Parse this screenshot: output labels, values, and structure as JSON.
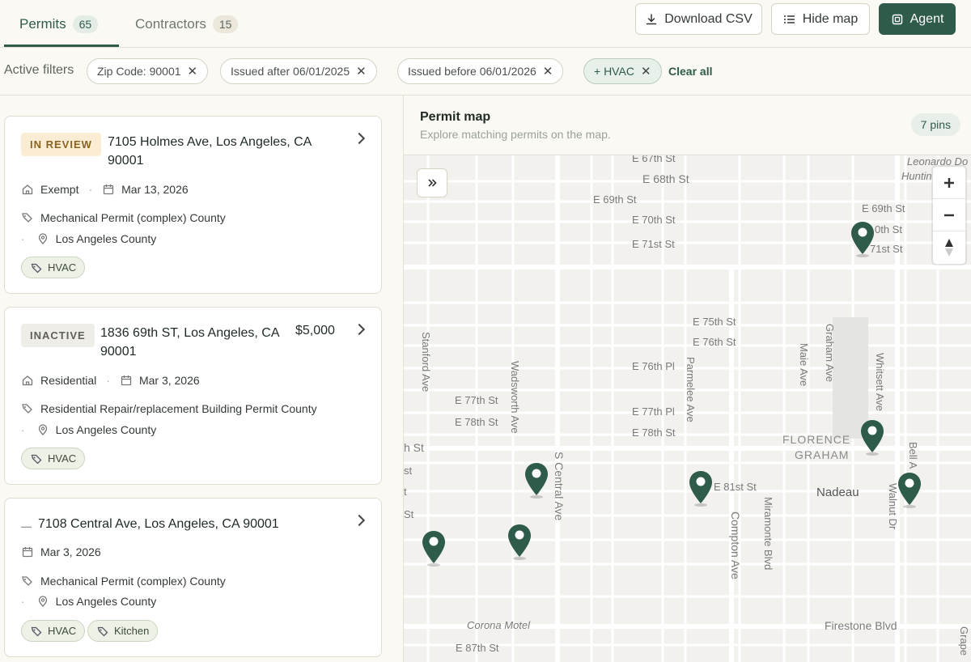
{
  "tabs": [
    {
      "label": "Permits",
      "count": "65"
    },
    {
      "label": "Contractors",
      "count": "15"
    }
  ],
  "actions": {
    "download": "Download CSV",
    "hide_map": "Hide map",
    "agent": "Agent"
  },
  "filters": {
    "label": "Active filters",
    "chips": [
      "Zip Code: 90001",
      "Issued after 06/01/2025",
      "Issued before 06/01/2026",
      "+ HVAC"
    ],
    "clear": "Clear all"
  },
  "permits": [
    {
      "status": "IN REVIEW",
      "address_line1": "7105 Holmes Ave, Los Angeles, CA",
      "address_line2": "90001",
      "price": "",
      "type": "Exempt",
      "date": "Mar 13, 2026",
      "permit_desc": "Mechanical Permit (complex) County",
      "jurisdiction": "Los Angeles County",
      "tags": [
        "HVAC"
      ]
    },
    {
      "status": "INACTIVE",
      "address_line1": "1836 69th ST, Los Angeles, CA",
      "address_line2": "90001",
      "price": "$5,000",
      "type": "Residential",
      "date": "Mar 3, 2026",
      "permit_desc": "Residential Repair/replacement Building Permit County",
      "jurisdiction": "Los Angeles County",
      "tags": [
        "HVAC"
      ]
    },
    {
      "status": "—",
      "address_line1": "7108 Central Ave, Los Angeles, CA 90001",
      "address_line2": "",
      "price": "",
      "type": "",
      "date": "Mar 3, 2026",
      "permit_desc": "Mechanical Permit (complex) County",
      "jurisdiction": "Los Angeles County",
      "tags": [
        "HVAC",
        "Kitchen"
      ]
    }
  ],
  "map": {
    "title": "Permit map",
    "subtitle": "Explore matching permits on the map.",
    "pins_label": "7 pins",
    "streets": {
      "e67": "E 67th St",
      "e68": "E 68th St",
      "e69": "E 69th St",
      "e70": "E 70th St",
      "e71": "E 71st St",
      "e69r": "E 69th St",
      "e70r": "0th St",
      "e71r": "71st St",
      "e75": "E 75th St",
      "e76": "E 76th St",
      "e76pl": "E 76th Pl",
      "e77pl": "E 77th Pl",
      "e78r": "E 78th St",
      "e77": "E 77th St",
      "e78": "E 78th St",
      "e81": "E 81st St",
      "e87": "E 87th St",
      "hst": "h St",
      "st1": "st",
      "st2": "t",
      "st3": "St",
      "stanford": "Stanford Ave",
      "wadsworth": "Wadsworth Ave",
      "central": "S Central Ave",
      "parmelee": "Parmelee Ave",
      "maie": "Maie Ave",
      "graham": "Graham Ave",
      "whitsett": "Whitsett Ave",
      "bell": "Bell A",
      "walnut": "Walnut Dr",
      "compton": "Compton Ave",
      "miramonte": "Miramonte Blvd",
      "florence": "FLORENCE",
      "graham_area": "GRAHAM",
      "nadeau": "Nadeau",
      "leonardo1": "Leonardo Do",
      "leonardo2": "Huntin",
      "corona": "Corona Motel",
      "firestone": "Firestone Blvd",
      "grape": "Grape"
    },
    "accent_color": "#2e5b4a"
  }
}
